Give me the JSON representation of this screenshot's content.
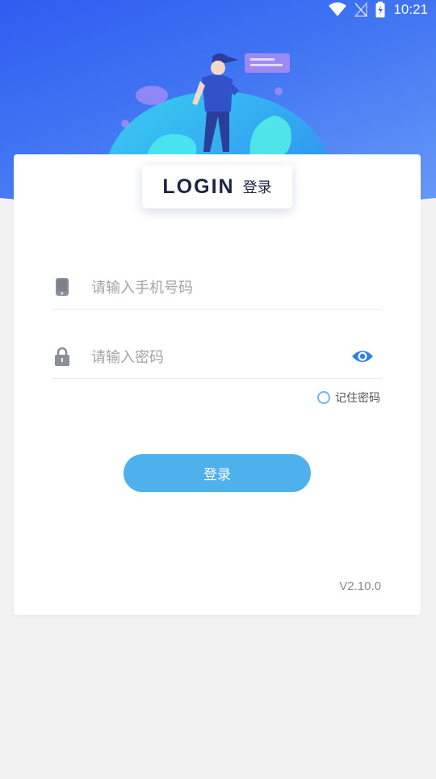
{
  "status_bar": {
    "time": "10:21"
  },
  "header": {
    "title_en": "LOGIN",
    "title_cn": "登录"
  },
  "form": {
    "phone_placeholder": "请输入手机号码",
    "phone_value": "",
    "password_placeholder": "请输入密码",
    "password_value": "",
    "remember_label": "记住密码",
    "remember_checked": false,
    "submit_label": "登录"
  },
  "footer": {
    "version": "V2.10.0"
  },
  "icons": {
    "phone": "phone-icon",
    "lock": "lock-icon",
    "eye": "eye-icon",
    "wifi": "wifi-icon",
    "signal": "signal-icon",
    "battery": "battery-icon"
  },
  "colors": {
    "accent": "#4fb1ec",
    "hero_start": "#2f5df0",
    "hero_end": "#6a9cf7",
    "text_dark": "#1b2440"
  }
}
